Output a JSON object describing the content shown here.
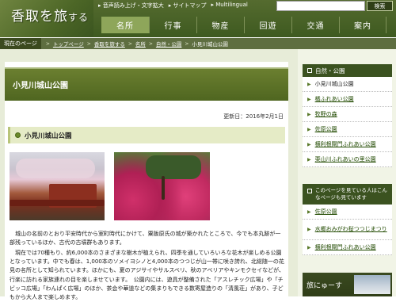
{
  "header": {
    "logo_main": "香取を旅",
    "logo_small": "する",
    "util": [
      "音声読み上げ・文字拡大",
      "サイトマップ",
      "Multilingual"
    ],
    "search_placeholder": "",
    "search_label": "検索",
    "nav": [
      "名所",
      "行事",
      "物産",
      "回遊",
      "交通",
      "案内"
    ],
    "active_nav": 0
  },
  "breadcrumb": {
    "head": "現在のページ",
    "items": [
      "トップページ",
      "香取を旅する",
      "名所",
      "自然・公園",
      "小見川城山公園"
    ]
  },
  "main": {
    "page_title": "小見川城山公園",
    "updated": "更新日：2016年2月1日",
    "section_title": "小見川城山公園",
    "para1": "城山の名前のとおり平安時代から室町時代にかけて、粟飯原氏の城が築かれたところで、今でも本丸跡が一部残っているほか、古代の古墳群もあります。",
    "para2": "現在では70種もり、約6,000本のさまざまな樹木が植えられ、四季を通していろいろな花木が楽しめる公園となっています。中でも春は、1,000本のソメイヨシノと4,000本のつつじが山一帯に咲き誇れ、北総随一の花見の名所として知られています。ほかにも、夏のアジサイやサルスベリ、秋のアベリアやキンモクセイなどが、行楽に訪れる家族連れの目を楽しませています。　公園内には、遊具が整備された「アスレチック広場」や「チビッコ広場」「わんぱく広場」のほか、茶会や華道などの集まりもできる数寄屋造りの「清風荘」があり、子どもから大人まで楽しめます。"
  },
  "sidebar": {
    "box_title": "自然・公園",
    "items": [
      "小見川城山公園",
      "橘ふれあい公園",
      "牧野の森",
      "佐原公園",
      "横利根閘門ふれあい公園",
      "栗山川ふれあいの里公園"
    ],
    "box2_title": "このページを見ている人はこんなページも見ています",
    "related": [
      "佐原公園",
      "水郷おみがわ桜つつじまつり",
      "横利根閘門ふれあい公園"
    ],
    "banner_text": "旅にゅーす"
  },
  "colors": {
    "header_bg": "#4a6424",
    "nav_active": "#8ea65a",
    "crumb_bg": "#5e6e40",
    "accent": "#3b5220"
  }
}
